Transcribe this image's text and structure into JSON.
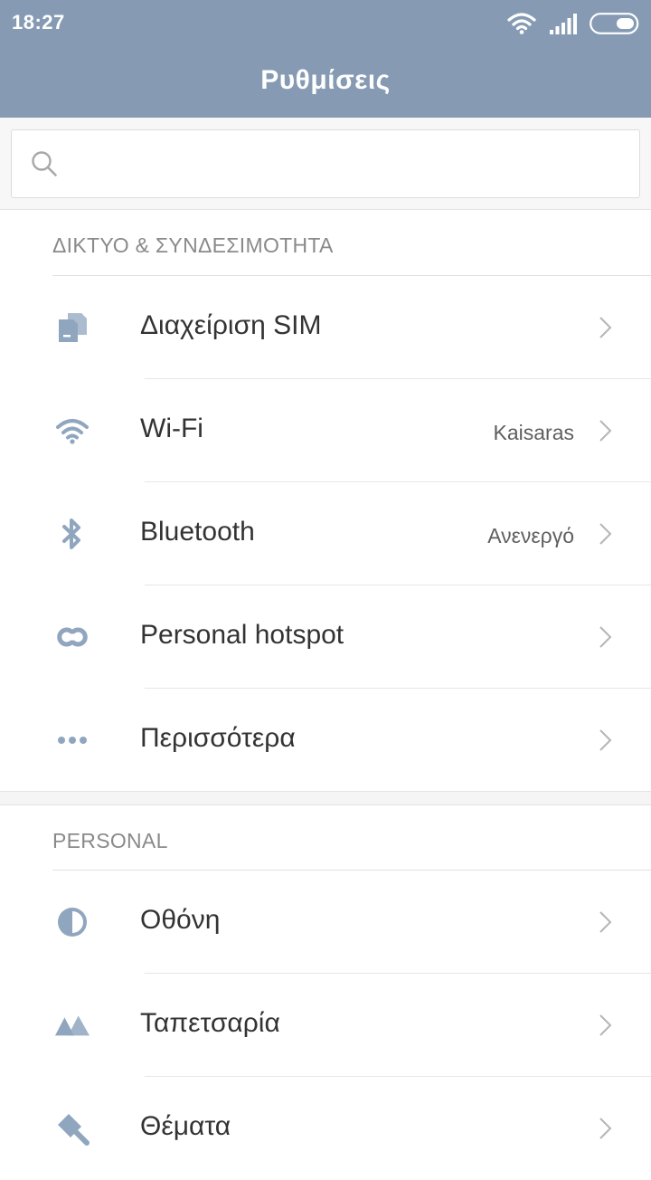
{
  "status_bar": {
    "time": "18:27"
  },
  "header": {
    "title": "Ρυθμίσεις"
  },
  "search": {
    "placeholder": ""
  },
  "colors": {
    "header_bg": "#869bb3",
    "icon_tint": "#90a6bf"
  },
  "sections": [
    {
      "title": "ΔΙΚΤΥΟ & ΣΥΝΔΕΣΙΜΟΤΗΤΑ",
      "items": [
        {
          "icon": "sim-card-icon",
          "label": "Διαχείριση SIM",
          "value": ""
        },
        {
          "icon": "wifi-icon",
          "label": "Wi-Fi",
          "value": "Kaisaras"
        },
        {
          "icon": "bluetooth-icon",
          "label": "Bluetooth",
          "value": "Ανενεργό"
        },
        {
          "icon": "hotspot-icon",
          "label": "Personal hotspot",
          "value": ""
        },
        {
          "icon": "more-dots-icon",
          "label": "Περισσότερα",
          "value": ""
        }
      ]
    },
    {
      "title": "PERSONAL",
      "items": [
        {
          "icon": "display-icon",
          "label": "Οθόνη",
          "value": ""
        },
        {
          "icon": "wallpaper-icon",
          "label": "Ταπετσαρία",
          "value": ""
        },
        {
          "icon": "themes-icon",
          "label": "Θέματα",
          "value": ""
        }
      ]
    }
  ]
}
